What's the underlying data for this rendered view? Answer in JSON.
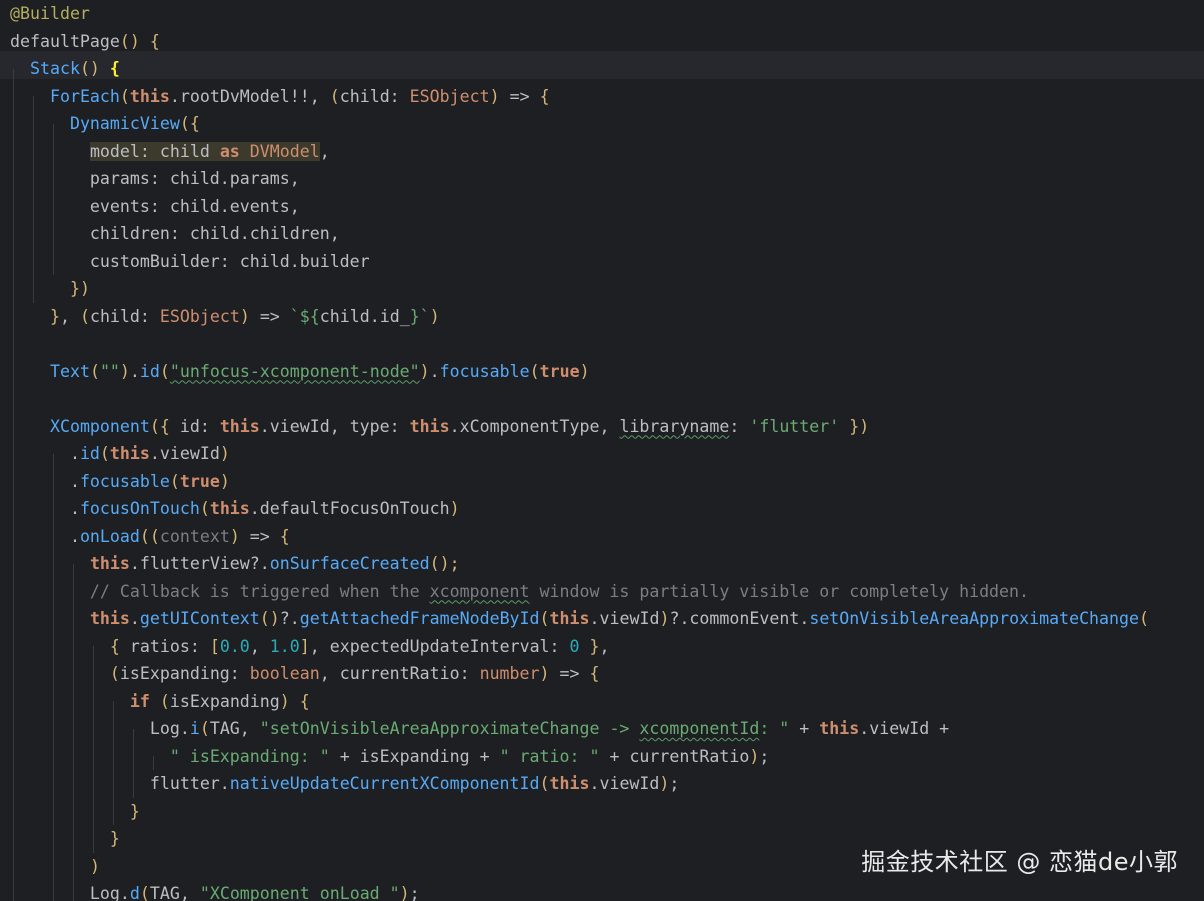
{
  "editor": {
    "theme_colors": {
      "background": "#1e1f22",
      "keyword": "#cf8e6d",
      "function": "#57aaf7",
      "string": "#6aab73",
      "number": "#2aacb8",
      "comment": "#7a7e85",
      "annotation": "#b3ae60",
      "text": "#bcbec4"
    },
    "lines": [
      [
        {
          "t": "@Builder",
          "c": "c-ann"
        }
      ],
      [
        {
          "t": "defaultPage",
          "c": "c-plain"
        },
        {
          "t": "()",
          "c": "c-paren"
        },
        {
          "t": " ",
          "c": "c-plain"
        },
        {
          "t": "{",
          "c": "c-brace"
        }
      ],
      [
        {
          "t": "  ",
          "c": "c-plain"
        },
        {
          "t": "Stack",
          "c": "c-fn"
        },
        {
          "t": "()",
          "c": "c-paren"
        },
        {
          "t": " ",
          "c": "c-plain"
        },
        {
          "t": "{",
          "c": "c-brace-hl"
        }
      ],
      [
        {
          "t": "    ",
          "c": "c-plain"
        },
        {
          "t": "ForEach",
          "c": "c-fn"
        },
        {
          "t": "(",
          "c": "c-paren"
        },
        {
          "t": "this",
          "c": "c-this"
        },
        {
          "t": ".rootDvModel!!, ",
          "c": "c-plain"
        },
        {
          "t": "(",
          "c": "c-paren"
        },
        {
          "t": "child: ",
          "c": "c-plain"
        },
        {
          "t": "ESObject",
          "c": "c-type"
        },
        {
          "t": ")",
          "c": "c-paren"
        },
        {
          "t": " => ",
          "c": "c-plain"
        },
        {
          "t": "{",
          "c": "c-brace"
        }
      ],
      [
        {
          "t": "      ",
          "c": "c-plain"
        },
        {
          "t": "DynamicView",
          "c": "c-fn"
        },
        {
          "t": "({",
          "c": "c-brace"
        }
      ],
      [
        {
          "t": "        ",
          "c": "c-plain"
        },
        {
          "t": "model: child ",
          "c": "c-plain hl-bg"
        },
        {
          "t": "as",
          "c": "c-kwb hl-bg"
        },
        {
          "t": " ",
          "c": "c-plain hl-bg"
        },
        {
          "t": "DVModel",
          "c": "c-type hl-bg"
        },
        {
          "t": ",",
          "c": "c-plain"
        }
      ],
      [
        {
          "t": "        params: child.params,",
          "c": "c-plain"
        }
      ],
      [
        {
          "t": "        events: child.events,",
          "c": "c-plain"
        }
      ],
      [
        {
          "t": "        children: child.children,",
          "c": "c-plain"
        }
      ],
      [
        {
          "t": "        customBuilder: child.builder",
          "c": "c-plain"
        }
      ],
      [
        {
          "t": "      ",
          "c": "c-plain"
        },
        {
          "t": "})",
          "c": "c-brace"
        }
      ],
      [
        {
          "t": "    ",
          "c": "c-plain"
        },
        {
          "t": "}",
          "c": "c-brace"
        },
        {
          "t": ", ",
          "c": "c-plain"
        },
        {
          "t": "(",
          "c": "c-paren"
        },
        {
          "t": "child: ",
          "c": "c-plain"
        },
        {
          "t": "ESObject",
          "c": "c-type"
        },
        {
          "t": ")",
          "c": "c-paren"
        },
        {
          "t": " => ",
          "c": "c-plain"
        },
        {
          "t": "`${",
          "c": "c-str"
        },
        {
          "t": "child.id_",
          "c": "c-plain"
        },
        {
          "t": "}`",
          "c": "c-str"
        },
        {
          "t": ")",
          "c": "c-paren"
        }
      ],
      [
        {
          "t": "",
          "c": "c-plain"
        }
      ],
      [
        {
          "t": "    ",
          "c": "c-plain"
        },
        {
          "t": "Text",
          "c": "c-fn"
        },
        {
          "t": "(",
          "c": "c-paren"
        },
        {
          "t": "\"\"",
          "c": "c-str"
        },
        {
          "t": ")",
          "c": "c-paren"
        },
        {
          "t": ".",
          "c": "c-plain"
        },
        {
          "t": "id",
          "c": "c-fn"
        },
        {
          "t": "(",
          "c": "c-paren"
        },
        {
          "t": "\"unfocus-xcomponent-node\"",
          "c": "c-str squig"
        },
        {
          "t": ")",
          "c": "c-paren"
        },
        {
          "t": ".",
          "c": "c-plain"
        },
        {
          "t": "focusable",
          "c": "c-fn"
        },
        {
          "t": "(",
          "c": "c-paren"
        },
        {
          "t": "true",
          "c": "c-kwb"
        },
        {
          "t": ")",
          "c": "c-paren"
        }
      ],
      [
        {
          "t": "",
          "c": "c-plain"
        }
      ],
      [
        {
          "t": "    ",
          "c": "c-plain"
        },
        {
          "t": "XComponent",
          "c": "c-fn"
        },
        {
          "t": "({",
          "c": "c-brace"
        },
        {
          "t": " id: ",
          "c": "c-plain"
        },
        {
          "t": "this",
          "c": "c-this"
        },
        {
          "t": ".viewId, type: ",
          "c": "c-plain"
        },
        {
          "t": "this",
          "c": "c-this"
        },
        {
          "t": ".xComponentType, ",
          "c": "c-plain"
        },
        {
          "t": "libraryname",
          "c": "c-plain squig"
        },
        {
          "t": ": ",
          "c": "c-plain"
        },
        {
          "t": "'flutter'",
          "c": "c-str"
        },
        {
          "t": " ",
          "c": "c-plain"
        },
        {
          "t": "})",
          "c": "c-brace"
        }
      ],
      [
        {
          "t": "      .",
          "c": "c-plain"
        },
        {
          "t": "id",
          "c": "c-fn"
        },
        {
          "t": "(",
          "c": "c-paren"
        },
        {
          "t": "this",
          "c": "c-this"
        },
        {
          "t": ".viewId",
          "c": "c-plain"
        },
        {
          "t": ")",
          "c": "c-paren"
        }
      ],
      [
        {
          "t": "      .",
          "c": "c-plain"
        },
        {
          "t": "focusable",
          "c": "c-fn"
        },
        {
          "t": "(",
          "c": "c-paren"
        },
        {
          "t": "true",
          "c": "c-kwb"
        },
        {
          "t": ")",
          "c": "c-paren"
        }
      ],
      [
        {
          "t": "      .",
          "c": "c-plain"
        },
        {
          "t": "focusOnTouch",
          "c": "c-fn"
        },
        {
          "t": "(",
          "c": "c-paren"
        },
        {
          "t": "this",
          "c": "c-this"
        },
        {
          "t": ".defaultFocusOnTouch",
          "c": "c-plain"
        },
        {
          "t": ")",
          "c": "c-paren"
        }
      ],
      [
        {
          "t": "      .",
          "c": "c-plain"
        },
        {
          "t": "onLoad",
          "c": "c-fn"
        },
        {
          "t": "((",
          "c": "c-paren"
        },
        {
          "t": "context",
          "c": "c-muted"
        },
        {
          "t": ")",
          "c": "c-paren"
        },
        {
          "t": " => ",
          "c": "c-plain"
        },
        {
          "t": "{",
          "c": "c-brace"
        }
      ],
      [
        {
          "t": "        ",
          "c": "c-plain"
        },
        {
          "t": "this",
          "c": "c-this"
        },
        {
          "t": ".flutterView?.",
          "c": "c-plain"
        },
        {
          "t": "onSurfaceCreated",
          "c": "c-fn"
        },
        {
          "t": "();",
          "c": "c-paren"
        }
      ],
      [
        {
          "t": "        // Callback is triggered when the ",
          "c": "c-comment"
        },
        {
          "t": "xcomponent",
          "c": "c-comment squig"
        },
        {
          "t": " window is partially visible or completely hidden.",
          "c": "c-comment"
        }
      ],
      [
        {
          "t": "        ",
          "c": "c-plain"
        },
        {
          "t": "this",
          "c": "c-this"
        },
        {
          "t": ".",
          "c": "c-plain"
        },
        {
          "t": "getUIContext",
          "c": "c-fn"
        },
        {
          "t": "()",
          "c": "c-paren"
        },
        {
          "t": "?.",
          "c": "c-plain"
        },
        {
          "t": "getAttachedFrameNodeById",
          "c": "c-fn"
        },
        {
          "t": "(",
          "c": "c-paren"
        },
        {
          "t": "this",
          "c": "c-this"
        },
        {
          "t": ".viewId",
          "c": "c-plain"
        },
        {
          "t": ")",
          "c": "c-paren"
        },
        {
          "t": "?.commonEvent.",
          "c": "c-plain"
        },
        {
          "t": "setOnVisibleAreaApproximateChange",
          "c": "c-fn"
        },
        {
          "t": "(",
          "c": "c-paren"
        }
      ],
      [
        {
          "t": "          ",
          "c": "c-plain"
        },
        {
          "t": "{",
          "c": "c-brace"
        },
        {
          "t": " ratios: ",
          "c": "c-plain"
        },
        {
          "t": "[",
          "c": "c-brace"
        },
        {
          "t": "0.0",
          "c": "c-num"
        },
        {
          "t": ", ",
          "c": "c-plain"
        },
        {
          "t": "1.0",
          "c": "c-num"
        },
        {
          "t": "]",
          "c": "c-brace"
        },
        {
          "t": ", expectedUpdateInterval: ",
          "c": "c-plain"
        },
        {
          "t": "0",
          "c": "c-num"
        },
        {
          "t": " ",
          "c": "c-plain"
        },
        {
          "t": "}",
          "c": "c-brace"
        },
        {
          "t": ",",
          "c": "c-plain"
        }
      ],
      [
        {
          "t": "          ",
          "c": "c-plain"
        },
        {
          "t": "(",
          "c": "c-paren"
        },
        {
          "t": "isExpanding: ",
          "c": "c-plain"
        },
        {
          "t": "boolean",
          "c": "c-type"
        },
        {
          "t": ", currentRatio: ",
          "c": "c-plain"
        },
        {
          "t": "number",
          "c": "c-type"
        },
        {
          "t": ")",
          "c": "c-paren"
        },
        {
          "t": " => ",
          "c": "c-plain"
        },
        {
          "t": "{",
          "c": "c-brace"
        }
      ],
      [
        {
          "t": "            ",
          "c": "c-plain"
        },
        {
          "t": "if",
          "c": "c-kwb"
        },
        {
          "t": " ",
          "c": "c-plain"
        },
        {
          "t": "(",
          "c": "c-paren"
        },
        {
          "t": "isExpanding",
          "c": "c-plain"
        },
        {
          "t": ")",
          "c": "c-paren"
        },
        {
          "t": " ",
          "c": "c-plain"
        },
        {
          "t": "{",
          "c": "c-brace"
        }
      ],
      [
        {
          "t": "              Log.",
          "c": "c-plain"
        },
        {
          "t": "i",
          "c": "c-fn"
        },
        {
          "t": "(",
          "c": "c-paren"
        },
        {
          "t": "TAG, ",
          "c": "c-plain"
        },
        {
          "t": "\"setOnVisibleAreaApproximateChange -> ",
          "c": "c-str"
        },
        {
          "t": "xcomponentId",
          "c": "c-str squig"
        },
        {
          "t": ": \"",
          "c": "c-str"
        },
        {
          "t": " + ",
          "c": "c-plain"
        },
        {
          "t": "this",
          "c": "c-this"
        },
        {
          "t": ".viewId +",
          "c": "c-plain"
        }
      ],
      [
        {
          "t": "                ",
          "c": "c-plain"
        },
        {
          "t": "\" isExpanding: \"",
          "c": "c-str"
        },
        {
          "t": " + isExpanding + ",
          "c": "c-plain"
        },
        {
          "t": "\" ratio: \"",
          "c": "c-str"
        },
        {
          "t": " + currentRatio",
          "c": "c-plain"
        },
        {
          "t": ")",
          "c": "c-paren"
        },
        {
          "t": ";",
          "c": "c-plain"
        }
      ],
      [
        {
          "t": "              flutter.",
          "c": "c-plain"
        },
        {
          "t": "nativeUpdateCurrentXComponentId",
          "c": "c-fn"
        },
        {
          "t": "(",
          "c": "c-paren"
        },
        {
          "t": "this",
          "c": "c-this"
        },
        {
          "t": ".viewId",
          "c": "c-plain"
        },
        {
          "t": ")",
          "c": "c-paren"
        },
        {
          "t": ";",
          "c": "c-plain"
        }
      ],
      [
        {
          "t": "            ",
          "c": "c-plain"
        },
        {
          "t": "}",
          "c": "c-brace"
        }
      ],
      [
        {
          "t": "          ",
          "c": "c-plain"
        },
        {
          "t": "}",
          "c": "c-brace"
        }
      ],
      [
        {
          "t": "        ",
          "c": "c-plain"
        },
        {
          "t": ")",
          "c": "c-paren"
        }
      ],
      [
        {
          "t": "        Log.",
          "c": "c-plain"
        },
        {
          "t": "d",
          "c": "c-fn"
        },
        {
          "t": "(",
          "c": "c-paren"
        },
        {
          "t": "TAG, ",
          "c": "c-plain"
        },
        {
          "t": "\"XComponent onLoad \"",
          "c": "c-str"
        },
        {
          "t": ")",
          "c": "c-paren"
        },
        {
          "t": ";",
          "c": "c-plain"
        }
      ]
    ]
  },
  "watermark": {
    "text": "掘金技术社区 @ 恋猫de小郭"
  }
}
